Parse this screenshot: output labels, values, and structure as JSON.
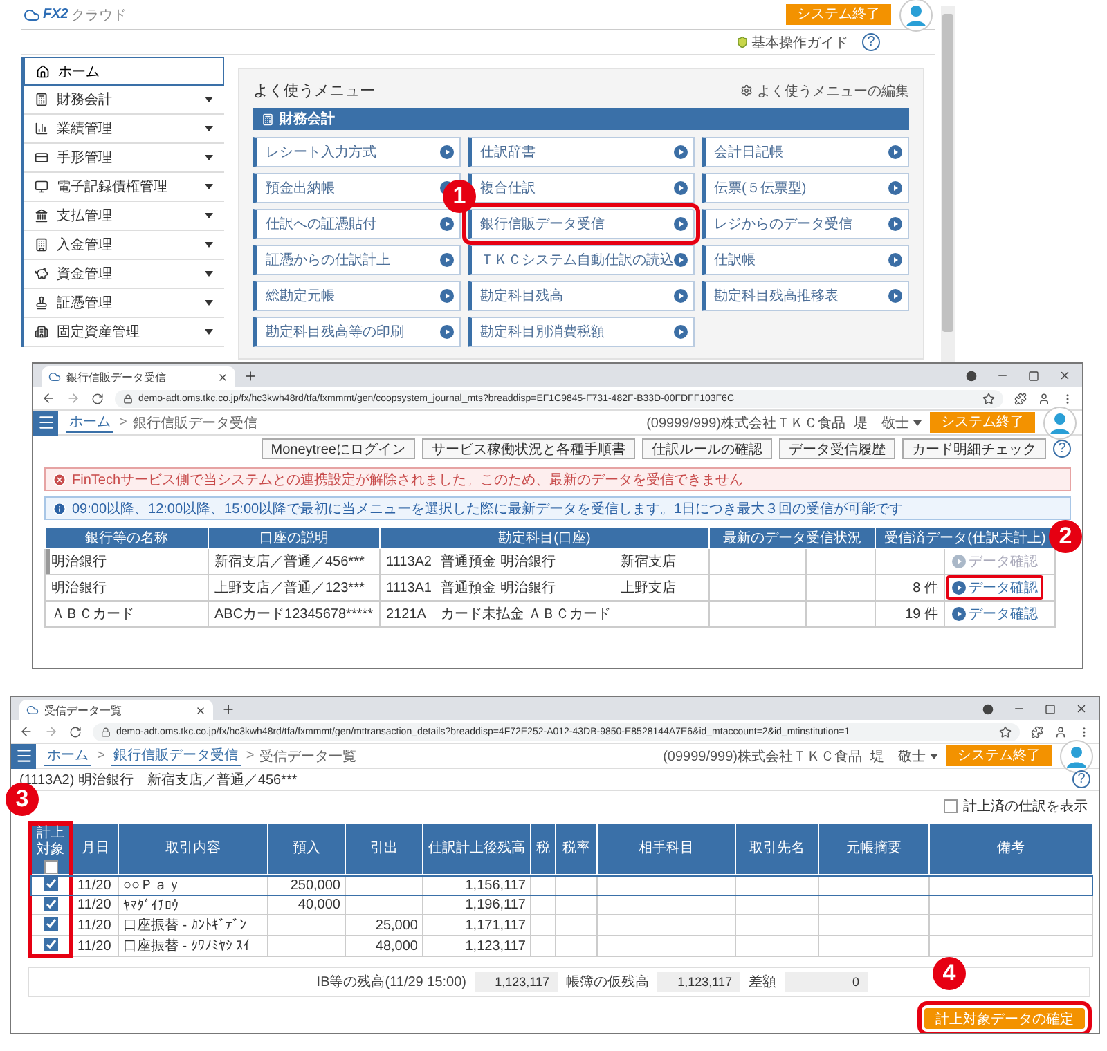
{
  "top_window": {
    "logo_mark": "FX2",
    "logo_text": "クラウド",
    "system_end": "システム終了",
    "guide_link": "基本操作ガイド",
    "help": "?",
    "sidebar": {
      "items": [
        {
          "label": "ホーム",
          "selected": true,
          "expandable": false
        },
        {
          "label": "財務会計",
          "selected": false,
          "expandable": true
        },
        {
          "label": "業績管理",
          "selected": false,
          "expandable": true
        },
        {
          "label": "手形管理",
          "selected": false,
          "expandable": true
        },
        {
          "label": "電子記録債権管理",
          "selected": false,
          "expandable": true
        },
        {
          "label": "支払管理",
          "selected": false,
          "expandable": true
        },
        {
          "label": "入金管理",
          "selected": false,
          "expandable": true
        },
        {
          "label": "資金管理",
          "selected": false,
          "expandable": true
        },
        {
          "label": "証憑管理",
          "selected": false,
          "expandable": true
        },
        {
          "label": "固定資産管理",
          "selected": false,
          "expandable": true
        }
      ]
    },
    "menu": {
      "title": "よく使うメニュー",
      "edit_link": "よく使うメニューの編集",
      "section": "財務会計",
      "items": [
        {
          "label": "レシート入力方式",
          "highlighted": false
        },
        {
          "label": "仕訳辞書",
          "highlighted": false
        },
        {
          "label": "会計日記帳",
          "highlighted": false
        },
        {
          "label": "預金出納帳",
          "highlighted": false
        },
        {
          "label": "複合仕訳",
          "highlighted": false
        },
        {
          "label": "伝票(５伝票型)",
          "highlighted": false
        },
        {
          "label": "仕訳への証憑貼付",
          "highlighted": false
        },
        {
          "label": "銀行信販データ受信",
          "highlighted": true
        },
        {
          "label": "レジからのデータ受信",
          "highlighted": false
        },
        {
          "label": "証憑からの仕訳計上",
          "highlighted": false
        },
        {
          "label": "ＴＫＣシステム自動仕訳の読込",
          "highlighted": false
        },
        {
          "label": "仕訳帳",
          "highlighted": false
        },
        {
          "label": "総勘定元帳",
          "highlighted": false
        },
        {
          "label": "勘定科目残高",
          "highlighted": false
        },
        {
          "label": "勘定科目残高推移表",
          "highlighted": false
        },
        {
          "label": "勘定科目残高等の印刷",
          "highlighted": false
        },
        {
          "label": "勘定科目別消費税額",
          "highlighted": false
        }
      ]
    }
  },
  "bank_window": {
    "tab_title": "銀行信販データ受信",
    "url": "demo-adt.oms.tkc.co.jp/fx/hc3kwh48rd/tfa/fxmmmt/gen/coopsystem_journal_mts?breaddisp=EF1C9845-F731-482F-B33D-00FDFF103F6C",
    "breadcrumb_separator": ">",
    "breadcrumbs": [
      {
        "label": "ホーム",
        "link": true
      },
      {
        "label": "銀行信販データ受信",
        "link": false
      }
    ],
    "company": "(09999/999)株式会社ＴＫＣ食品",
    "user": "堤　敬士",
    "system_end": "システム終了",
    "help": "?",
    "toolbar": [
      "Moneytreeにログイン",
      "サービス稼働状況と各種手順書",
      "仕訳ルールの確認",
      "データ受信履歴",
      "カード明細チェック"
    ],
    "alerts": [
      {
        "kind": "error",
        "text": "FinTechサービス側で当システムとの連携設定が解除されました。このため、最新のデータを受信できません"
      },
      {
        "kind": "info",
        "text": "09:00以降、12:00以降、15:00以降で最初に当メニューを選択した際に最新データを受信します。1日につき最大３回の受信が可能です"
      }
    ],
    "table": {
      "columns": [
        "銀行等の名称",
        "口座の説明",
        "勘定科目(口座)",
        "最新のデータ受信状況",
        "受信済データ(仕訳未計上)"
      ],
      "rows": [
        {
          "selected": true,
          "name": "明治銀行",
          "description": "新宿支店／普通／456***",
          "code": "1113A2",
          "account": "普通預金 明治銀行",
          "branch": "新宿支店",
          "action": {
            "label": "データ確認",
            "disabled": true,
            "highlighted": false
          }
        },
        {
          "selected": false,
          "name": "明治銀行",
          "description": "上野支店／普通／123***",
          "code": "1113A1",
          "account": "普通預金 明治銀行",
          "branch": "上野支店",
          "count": "8 件",
          "action": {
            "label": "データ確認",
            "disabled": false,
            "highlighted": true
          }
        },
        {
          "selected": false,
          "name": "ＡＢＣカード",
          "description": "ABCカード12345678*****",
          "code": "2121A",
          "account": "カード未払金 ＡＢＣカード",
          "count": "19 件",
          "action": {
            "label": "データ確認",
            "disabled": false,
            "highlighted": false
          }
        }
      ]
    }
  },
  "detail_window": {
    "tab_title": "受信データ一覧",
    "url": "demo-adt.oms.tkc.co.jp/fx/hc3kwh48rd/tfa/fxmmmt/gen/mttransaction_details?breaddisp=4F72E252-A012-43DB-9850-E8528144A7E6&id_mtaccount=2&id_mtinstitution=1",
    "breadcrumb_separator": ">",
    "breadcrumbs": [
      {
        "label": "ホーム",
        "link": true
      },
      {
        "label": "銀行信販データ受信",
        "link": true
      },
      {
        "label": "受信データ一覧",
        "link": false
      }
    ],
    "company": "(09999/999)株式会社ＴＫＣ食品",
    "user": "堤　敬士",
    "system_end": "システム終了",
    "help": "?",
    "subtitle": "(1113A2) 明治銀行　新宿支店／普通／456***",
    "show_posted": {
      "label": "計上済の仕訳を表示",
      "checked": false
    },
    "table": {
      "select_column_highlighted": true,
      "header_checked": false,
      "columns": [
        "計上対象",
        "月日",
        "取引内容",
        "預入",
        "引出",
        "仕訳計上後残高",
        "税",
        "税率",
        "相手科目",
        "取引先名",
        "元帳摘要",
        "備考"
      ],
      "rows": [
        {
          "checked": true,
          "selected": true,
          "date": "11/20",
          "description": "○○Ｐａｙ",
          "deposit": "250,000",
          "balance": "1,156,117"
        },
        {
          "checked": true,
          "selected": false,
          "date": "11/20",
          "description": "ﾔﾏﾀﾞｲﾁﾛｳ",
          "deposit": "40,000",
          "balance": "1,196,117"
        },
        {
          "checked": true,
          "selected": false,
          "date": "11/20",
          "description": "口座振替 - ｶﾝﾄｷﾞﾃﾞﾝ",
          "withdrawal": "25,000",
          "balance": "1,171,117"
        },
        {
          "checked": true,
          "selected": false,
          "date": "11/20",
          "description": "口座振替 - ｸﾜﾉﾐﾔｼ ｽｲ",
          "withdrawal": "48,000",
          "balance": "1,123,117"
        }
      ]
    },
    "totals": [
      {
        "label": "IB等の残高(11/29 15:00)",
        "value": "1,123,117"
      },
      {
        "label": "帳簿の仮残高",
        "value": "1,123,117"
      },
      {
        "label": "差額",
        "value": "0"
      }
    ],
    "confirm_button": {
      "label": "計上対象データの確定",
      "highlighted": true
    }
  },
  "annotations": [
    {
      "label": "1"
    },
    {
      "label": "2"
    },
    {
      "label": "3"
    },
    {
      "label": "4"
    }
  ]
}
